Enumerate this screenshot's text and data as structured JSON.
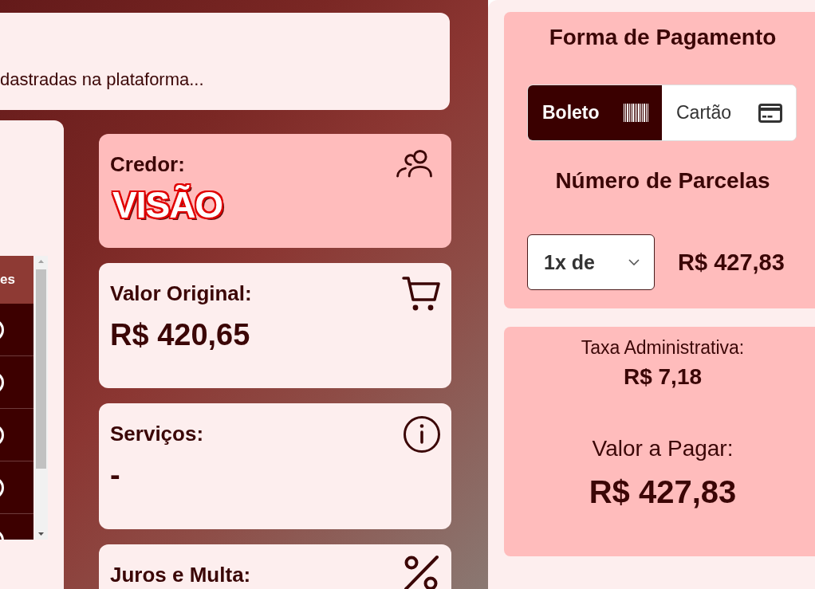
{
  "notice": {
    "text": "dastradas na plataforma..."
  },
  "table": {
    "columns": [
      "es"
    ],
    "rows": [
      {
        "kind": "ring"
      },
      {
        "kind": "ring"
      },
      {
        "kind": "ring"
      },
      {
        "kind": "ring"
      },
      {
        "kind": "ring"
      }
    ]
  },
  "cards": [
    {
      "kind": "creditor",
      "label": "Credor:",
      "logo": "VISÃO"
    },
    {
      "kind": "cart",
      "label": "Valor Original:",
      "value": "R$ 420,65"
    },
    {
      "kind": "info",
      "label": "Serviços:",
      "value": "-"
    },
    {
      "kind": "percent",
      "label": "Juros e Multa:"
    }
  ],
  "payment": {
    "title": "Forma de Pagamento",
    "methods": [
      {
        "kind": "barcode",
        "label": "Boleto",
        "selected": true
      },
      {
        "kind": "card",
        "label": "Cartão",
        "selected": false
      }
    ],
    "installments_title": "Número de Parcelas",
    "installments": {
      "value": "1x de"
    },
    "installment_amount": "R$ 427,83"
  },
  "totals": {
    "fee_label": "Taxa Administrativa:",
    "fee": "R$ 7,18",
    "total_label": "Valor a Pagar:",
    "total": "R$ 427,83"
  }
}
